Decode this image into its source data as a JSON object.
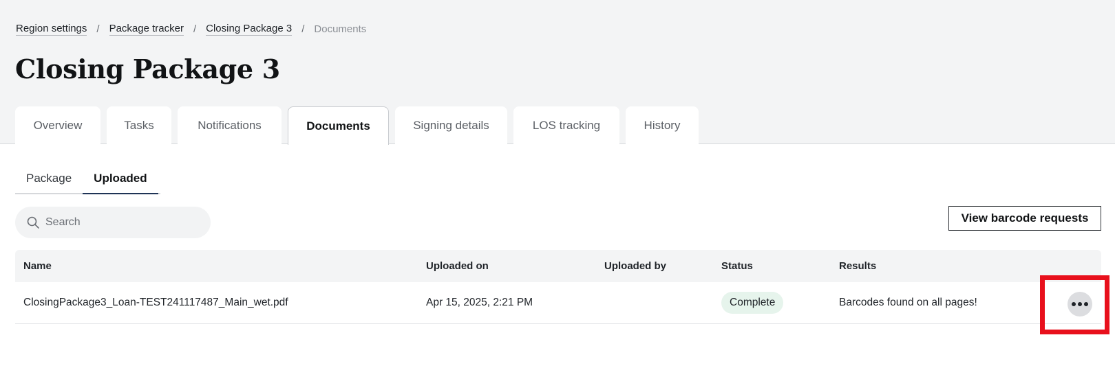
{
  "breadcrumb": {
    "items": [
      "Region settings",
      "Package tracker",
      "Closing Package 3"
    ],
    "current": "Documents",
    "separator": "/"
  },
  "page_title": "Closing Package 3",
  "tabs": [
    {
      "label": "Overview"
    },
    {
      "label": "Tasks"
    },
    {
      "label": "Notifications"
    },
    {
      "label": "Documents",
      "active": true
    },
    {
      "label": "Signing details"
    },
    {
      "label": "LOS tracking"
    },
    {
      "label": "History"
    }
  ],
  "subtabs": [
    {
      "label": "Package"
    },
    {
      "label": "Uploaded",
      "active": true
    }
  ],
  "search": {
    "placeholder": "Search",
    "icon": "search-icon"
  },
  "actions": {
    "view_barcode_requests": "View barcode requests"
  },
  "table": {
    "columns": [
      "Name",
      "Uploaded on",
      "Uploaded by",
      "Status",
      "Results"
    ],
    "rows": [
      {
        "name": "ClosingPackage3_Loan-TEST241117487_Main_wet.pdf",
        "uploaded_on": "Apr 15, 2025, 2:21 PM",
        "uploaded_by": "",
        "status": "Complete",
        "results": "Barcodes found on all pages!",
        "action_icon": "more-horizontal-icon"
      }
    ]
  },
  "colors": {
    "header_bg": "#f3f4f5",
    "status_complete_bg": "#e6f4ec",
    "highlight": "#e8101c",
    "subtab_underline": "#1f3456"
  }
}
